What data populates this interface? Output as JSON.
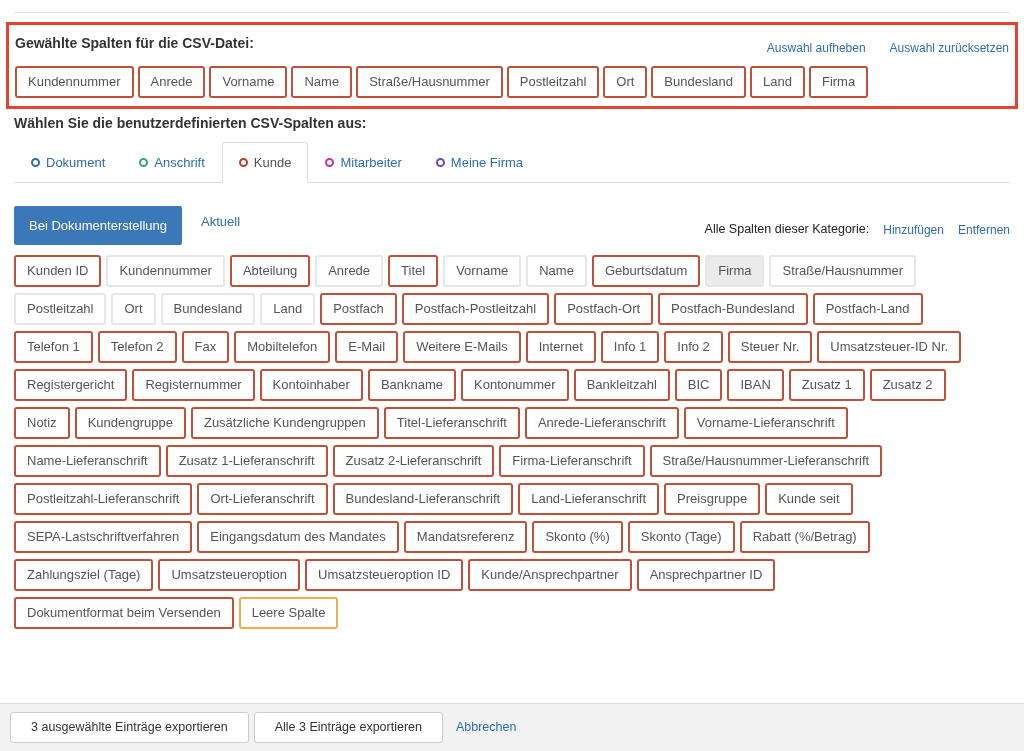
{
  "chosen": {
    "title": "Gewählte Spalten für die CSV-Datei:",
    "links": [
      "Auswahl aufheben",
      "Auswahl zurücksetzen"
    ],
    "columns": [
      "Kundennummer",
      "Anrede",
      "Vorname",
      "Name",
      "Straße/Hausnummer",
      "Postleitzahl",
      "Ort",
      "Bundesland",
      "Land",
      "Firma"
    ]
  },
  "custom_title": "Wählen Sie die benutzerdefinierten CSV-Spalten aus:",
  "tabs": [
    {
      "label": "Dokument",
      "color": "#2f6db5",
      "selected": false
    },
    {
      "label": "Anschrift",
      "color": "#3aa37a",
      "selected": false
    },
    {
      "label": "Kunde",
      "color": "#b9412c",
      "selected": true
    },
    {
      "label": "Mitarbeiter",
      "color": "#c0369a",
      "selected": false
    },
    {
      "label": "Meine Firma",
      "color": "#7046c2",
      "selected": false
    }
  ],
  "subtabs": [
    {
      "label": "Bei Dokumenterstellung",
      "selected": true
    },
    {
      "label": "Aktuell",
      "selected": false
    }
  ],
  "category": {
    "label": "Alle Spalten dieser Kategorie:",
    "links": [
      "Hinzufügen",
      "Entfernen"
    ]
  },
  "fields": [
    {
      "label": "Kunden ID",
      "kind": "field",
      "selected": true,
      "disabled": false
    },
    {
      "label": "Kundennummer",
      "kind": "field",
      "selected": false,
      "disabled": false
    },
    {
      "label": "Abteilung",
      "kind": "field",
      "selected": true,
      "disabled": false
    },
    {
      "label": "Anrede",
      "kind": "field",
      "selected": false,
      "disabled": false
    },
    {
      "label": "Titel",
      "kind": "field",
      "selected": true,
      "disabled": false
    },
    {
      "label": "Vorname",
      "kind": "field",
      "selected": false,
      "disabled": false
    },
    {
      "label": "Name",
      "kind": "field",
      "selected": false,
      "disabled": false
    },
    {
      "label": "Geburtsdatum",
      "kind": "field",
      "selected": true,
      "disabled": false
    },
    {
      "label": "Firma",
      "kind": "field",
      "selected": false,
      "disabled": true
    },
    {
      "label": "Straße/Hausnummer",
      "kind": "field",
      "selected": false,
      "disabled": false
    },
    {
      "label": "Postleitzahl",
      "kind": "field",
      "selected": false,
      "disabled": false
    },
    {
      "label": "Ort",
      "kind": "field",
      "selected": false,
      "disabled": false
    },
    {
      "label": "Bundesland",
      "kind": "field",
      "selected": false,
      "disabled": false
    },
    {
      "label": "Land",
      "kind": "field",
      "selected": false,
      "disabled": false
    },
    {
      "label": "Postfach",
      "kind": "field",
      "selected": true,
      "disabled": false
    },
    {
      "label": "Postfach-Postleitzahl",
      "kind": "field",
      "selected": true,
      "disabled": false
    },
    {
      "label": "Postfach-Ort",
      "kind": "field",
      "selected": true,
      "disabled": false
    },
    {
      "label": "Postfach-Bundesland",
      "kind": "field",
      "selected": true,
      "disabled": false
    },
    {
      "label": "Postfach-Land",
      "kind": "field",
      "selected": true,
      "disabled": false
    },
    {
      "label": "Telefon 1",
      "kind": "field",
      "selected": true,
      "disabled": false
    },
    {
      "label": "Telefon 2",
      "kind": "field",
      "selected": true,
      "disabled": false
    },
    {
      "label": "Fax",
      "kind": "field",
      "selected": true,
      "disabled": false
    },
    {
      "label": "Mobiltelefon",
      "kind": "field",
      "selected": true,
      "disabled": false
    },
    {
      "label": "E-Mail",
      "kind": "field",
      "selected": true,
      "disabled": false
    },
    {
      "label": "Weitere E-Mails",
      "kind": "field",
      "selected": true,
      "disabled": false
    },
    {
      "label": "Internet",
      "kind": "field",
      "selected": true,
      "disabled": false
    },
    {
      "label": "Info 1",
      "kind": "field",
      "selected": true,
      "disabled": false
    },
    {
      "label": "Info 2",
      "kind": "field",
      "selected": true,
      "disabled": false
    },
    {
      "label": "Steuer Nr.",
      "kind": "field",
      "selected": true,
      "disabled": false
    },
    {
      "label": "Umsatzsteuer-ID Nr.",
      "kind": "field",
      "selected": true,
      "disabled": false
    },
    {
      "label": "Registergericht",
      "kind": "field",
      "selected": true,
      "disabled": false
    },
    {
      "label": "Registernummer",
      "kind": "field",
      "selected": true,
      "disabled": false
    },
    {
      "label": "Kontoinhaber",
      "kind": "field",
      "selected": true,
      "disabled": false
    },
    {
      "label": "Bankname",
      "kind": "field",
      "selected": true,
      "disabled": false
    },
    {
      "label": "Kontonummer",
      "kind": "field",
      "selected": true,
      "disabled": false
    },
    {
      "label": "Bankleitzahl",
      "kind": "field",
      "selected": true,
      "disabled": false
    },
    {
      "label": "BIC",
      "kind": "field",
      "selected": true,
      "disabled": false
    },
    {
      "label": "IBAN",
      "kind": "field",
      "selected": true,
      "disabled": false
    },
    {
      "label": "Zusatz 1",
      "kind": "field",
      "selected": true,
      "disabled": false
    },
    {
      "label": "Zusatz 2",
      "kind": "field",
      "selected": true,
      "disabled": false
    },
    {
      "label": "Notiz",
      "kind": "field",
      "selected": true,
      "disabled": false
    },
    {
      "label": "Kundengruppe",
      "kind": "field",
      "selected": true,
      "disabled": false
    },
    {
      "label": "Zusätzliche Kundengruppen",
      "kind": "field",
      "selected": true,
      "disabled": false
    },
    {
      "label": "Titel-Lieferanschrift",
      "kind": "field",
      "selected": true,
      "disabled": false
    },
    {
      "label": "Anrede-Lieferanschrift",
      "kind": "field",
      "selected": true,
      "disabled": false
    },
    {
      "label": "Vorname-Lieferanschrift",
      "kind": "field",
      "selected": true,
      "disabled": false
    },
    {
      "label": "Name-Lieferanschrift",
      "kind": "field",
      "selected": true,
      "disabled": false
    },
    {
      "label": "Zusatz 1-Lieferanschrift",
      "kind": "field",
      "selected": true,
      "disabled": false
    },
    {
      "label": "Zusatz 2-Lieferanschrift",
      "kind": "field",
      "selected": true,
      "disabled": false
    },
    {
      "label": "Firma-Lieferanschrift",
      "kind": "field",
      "selected": true,
      "disabled": false
    },
    {
      "label": "Straße/Hausnummer-Lieferanschrift",
      "kind": "field",
      "selected": true,
      "disabled": false
    },
    {
      "label": "Postleitzahl-Lieferanschrift",
      "kind": "field",
      "selected": true,
      "disabled": false
    },
    {
      "label": "Ort-Lieferanschrift",
      "kind": "field",
      "selected": true,
      "disabled": false
    },
    {
      "label": "Bundesland-Lieferanschrift",
      "kind": "field",
      "selected": true,
      "disabled": false
    },
    {
      "label": "Land-Lieferanschrift",
      "kind": "field",
      "selected": true,
      "disabled": false
    },
    {
      "label": "Preisgruppe",
      "kind": "field",
      "selected": true,
      "disabled": false
    },
    {
      "label": "Kunde seit",
      "kind": "field",
      "selected": true,
      "disabled": false
    },
    {
      "label": "SEPA-Lastschriftverfahren",
      "kind": "field",
      "selected": true,
      "disabled": false
    },
    {
      "label": "Eingangsdatum des Mandates",
      "kind": "field",
      "selected": true,
      "disabled": false
    },
    {
      "label": "Mandatsreferenz",
      "kind": "field",
      "selected": true,
      "disabled": false
    },
    {
      "label": "Skonto (%)",
      "kind": "field",
      "selected": true,
      "disabled": false
    },
    {
      "label": "Skonto (Tage)",
      "kind": "field",
      "selected": true,
      "disabled": false
    },
    {
      "label": "Rabatt (%/Betrag)",
      "kind": "field",
      "selected": true,
      "disabled": false
    },
    {
      "label": "Zahlungsziel (Tage)",
      "kind": "field",
      "selected": true,
      "disabled": false
    },
    {
      "label": "Umsatzsteueroption",
      "kind": "field",
      "selected": true,
      "disabled": false
    },
    {
      "label": "Umsatzsteueroption ID",
      "kind": "field",
      "selected": true,
      "disabled": false
    },
    {
      "label": "Kunde/Ansprechpartner",
      "kind": "field",
      "selected": true,
      "disabled": false
    },
    {
      "label": "Ansprechpartner ID",
      "kind": "field",
      "selected": true,
      "disabled": false
    },
    {
      "label": "Dokumentformat beim Versenden",
      "kind": "field",
      "selected": true,
      "disabled": false
    },
    {
      "label": "Leere Spalte",
      "kind": "empty",
      "selected": false,
      "disabled": false
    }
  ],
  "footer": {
    "buttons": [
      "3 ausgewählte Einträge exportieren",
      "Alle 3 Einträge exportieren"
    ],
    "link": "Abbrechen"
  }
}
